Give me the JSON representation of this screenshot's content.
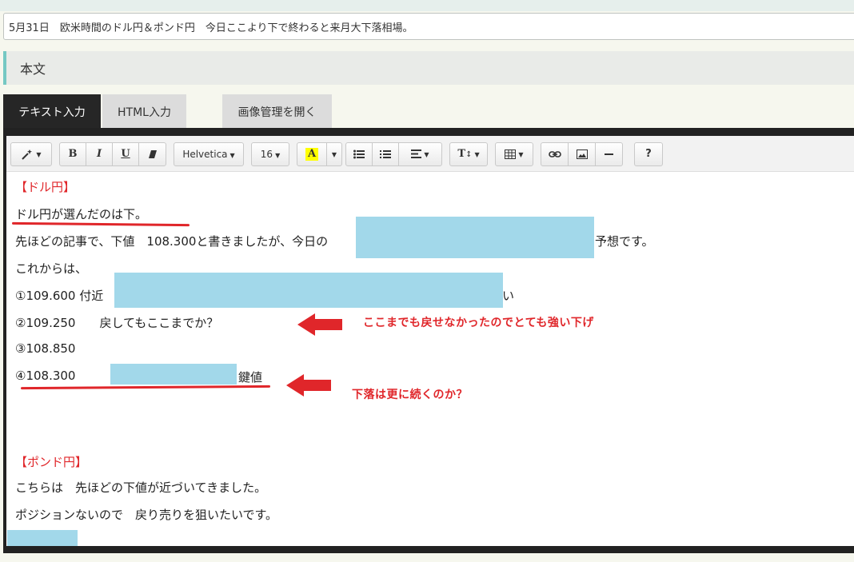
{
  "post": {
    "title": "5月31日　欧米時間のドル円＆ポンド円　今日ここより下で終わると来月大下落相場。"
  },
  "section": {
    "label": "本文"
  },
  "tabs": {
    "text_input": "テキスト入力",
    "html_input": "HTML入力",
    "image_manager": "画像管理を開く"
  },
  "toolbar": {
    "font": "Helvetica",
    "font_size": "16",
    "bold": "B",
    "italic": "I",
    "underline": "U",
    "highlight": "A",
    "text_style": "T",
    "help": "?"
  },
  "body": {
    "usdjpy_heading": "【ドル円】",
    "line1": "ドル円が選んだのは下。",
    "line2_left": "先ほどの記事で、下値　108.300と書きましたが、今日の",
    "line2_right": "予想です。",
    "line3": "これからは、",
    "line4_left": "①109.600 付近",
    "line4_right": "い",
    "line5": "②109.250　　戻してもここまでか？",
    "line6": "③108.850",
    "line7_left": "④108.300",
    "line7_right": "鍵値",
    "gbpjpy_heading": "【ポンド円】",
    "line8": "こちらは　先ほどの下値が近づいてきました。",
    "line9": "ポジションないので　戻り売りを狙いたいです。"
  },
  "annotations": {
    "note1": "ここまでも戻せなかったのでとても強い下げ",
    "note2": "下落は更に続くのか？"
  },
  "colors": {
    "annotation_red": "#e0262a",
    "redaction_blue": "#a2d8ea",
    "section_accent": "#75c8c3"
  }
}
